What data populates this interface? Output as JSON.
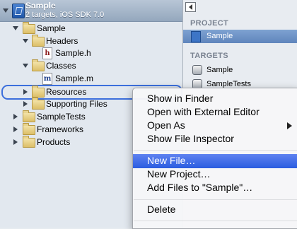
{
  "project": {
    "name": "Sample",
    "subtitle": "2 targets, iOS SDK 7.0"
  },
  "tree": {
    "sample_group": "Sample",
    "headers": "Headers",
    "sample_h": "Sample.h",
    "classes": "Classes",
    "sample_m": "Sample.m",
    "resources": "Resources",
    "supporting_files": "Supporting Files",
    "sample_tests": "SampleTests",
    "frameworks": "Frameworks",
    "products": "Products",
    "file_letter_h": "h",
    "file_letter_m": "m"
  },
  "inspector": {
    "project_header": "PROJECT",
    "project_item": "Sample",
    "targets_header": "TARGETS",
    "targets": [
      "Sample",
      "SampleTests"
    ]
  },
  "context_menu": {
    "items": [
      "Show in Finder",
      "Open with External Editor",
      "Open As",
      "Show File Inspector",
      "New File…",
      "New Project…",
      "Add Files to \"Sample\"…",
      "Delete"
    ],
    "highlighted": "New File…"
  },
  "colors": {
    "selection_accent": "#3c6fdc",
    "menu_highlight": "#2a5ce0"
  }
}
